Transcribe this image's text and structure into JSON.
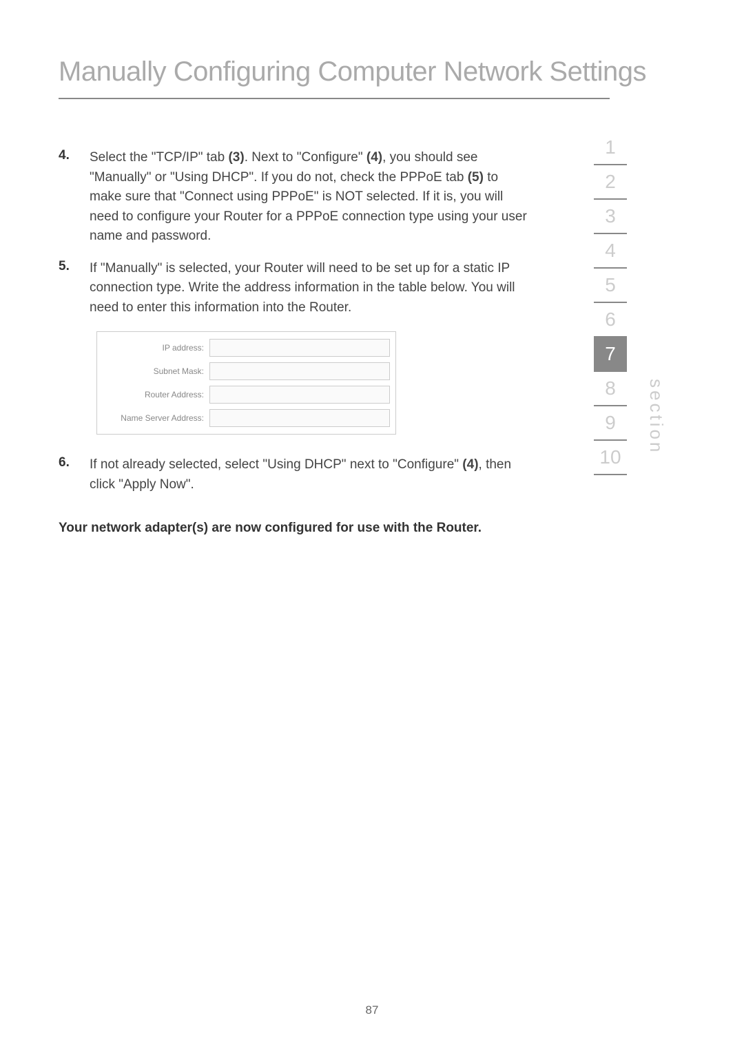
{
  "title": "Manually Configuring Computer Network Settings",
  "items": {
    "4": {
      "number": "4.",
      "text_parts": [
        "Select the \"TCP/IP\" tab ",
        "(3)",
        ". Next to \"Configure\" ",
        "(4)",
        ", you should see \"Manually\" or \"Using DHCP\". If you do not, check the PPPoE tab ",
        "(5)",
        " to make sure that \"Connect using PPPoE\" is NOT selected. If it is, you will need to configure your Router for a PPPoE connection type using your user name and password."
      ]
    },
    "5": {
      "number": "5.",
      "text": "If \"Manually\" is selected, your Router will need to be set up for a static IP connection type. Write the address information in the table below. You will need to enter this information into the Router."
    },
    "6": {
      "number": "6.",
      "text_parts": [
        "If not already selected, select \"Using DHCP\" next to \"Configure\" ",
        "(4)",
        ", then click \"Apply Now\"."
      ]
    }
  },
  "table": {
    "rows": [
      "IP address:",
      "Subnet Mask:",
      "Router Address:",
      "Name Server Address:"
    ]
  },
  "closing": "Your network adapter(s) are now configured for use with the Router.",
  "nav": {
    "items": [
      "1",
      "2",
      "3",
      "4",
      "5",
      "6",
      "7",
      "8",
      "9",
      "10"
    ],
    "active": "7"
  },
  "section_label": "section",
  "page_number": "87"
}
